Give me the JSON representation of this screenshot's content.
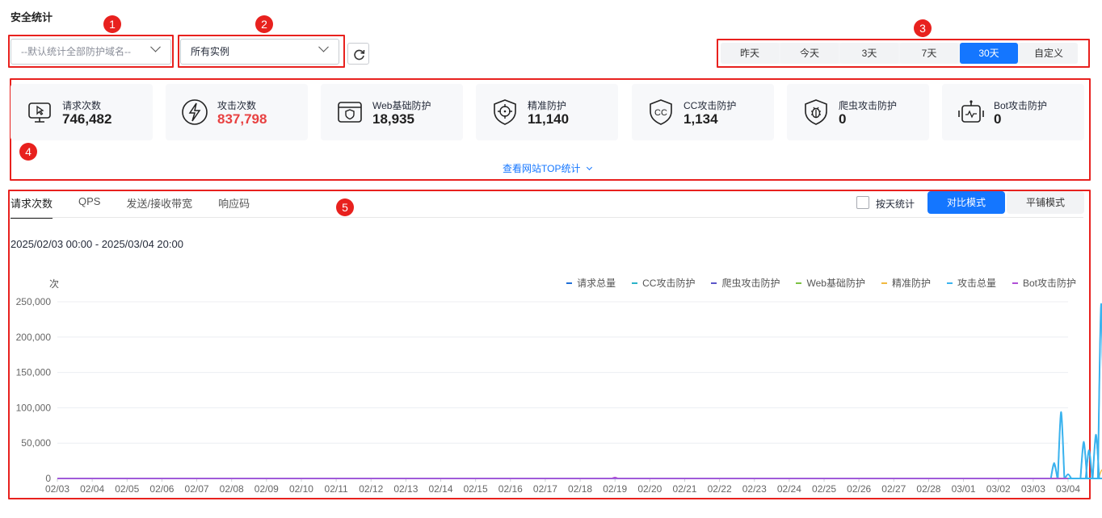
{
  "page_title": "安全统计",
  "badges": [
    "1",
    "2",
    "3",
    "4",
    "5"
  ],
  "domain_select": {
    "placeholder": "--默认统计全部防护域名--"
  },
  "instance_select": {
    "value": "所有实例"
  },
  "time_range": {
    "options": [
      "昨天",
      "今天",
      "3天",
      "7天",
      "30天",
      "自定义"
    ],
    "selected": "30天"
  },
  "stats": [
    {
      "label": "请求次数",
      "value": "746,482",
      "icon": "monitor-cursor-icon"
    },
    {
      "label": "攻击次数",
      "value": "837,798",
      "icon": "lightning-icon",
      "color": "#e84141"
    },
    {
      "label": "Web基础防护",
      "value": "18,935",
      "icon": "browser-shield-icon"
    },
    {
      "label": "精准防护",
      "value": "11,140",
      "icon": "target-shield-icon"
    },
    {
      "label": "CC攻击防护",
      "value": "1,134",
      "icon": "cc-shield-icon"
    },
    {
      "label": "爬虫攻击防护",
      "value": "0",
      "icon": "bug-shield-icon"
    },
    {
      "label": "Bot攻击防护",
      "value": "0",
      "icon": "bot-icon"
    }
  ],
  "top_link": "查看网站TOP统计",
  "tabs": [
    "请求次数",
    "QPS",
    "发送/接收带宽",
    "响应码"
  ],
  "daily_stat_label": "按天统计",
  "modes": [
    "对比模式",
    "平铺模式"
  ],
  "date_range": "2025/02/03 00:00 - 2025/03/04 20:00",
  "colors": {
    "accent": "#1476ff",
    "danger": "#e8211e"
  },
  "chart_data": {
    "type": "line",
    "ylabel": "次",
    "ylim": [
      0,
      250000
    ],
    "yticks": [
      "250,000",
      "200,000",
      "150,000",
      "100,000",
      "50,000",
      "0"
    ],
    "x": [
      "02/03",
      "02/04",
      "02/05",
      "02/06",
      "02/07",
      "02/08",
      "02/09",
      "02/10",
      "02/11",
      "02/12",
      "02/13",
      "02/14",
      "02/15",
      "02/16",
      "02/17",
      "02/18",
      "02/19",
      "02/20",
      "02/21",
      "02/22",
      "02/23",
      "02/24",
      "02/25",
      "02/26",
      "02/27",
      "02/28",
      "03/01",
      "03/02",
      "03/03",
      "03/04"
    ],
    "grid": true,
    "legend_position": "top-right",
    "series": [
      {
        "name": "请求总量",
        "color": "#1f6fd6",
        "peaks": [
          [
            28.6,
            20000
          ],
          [
            28.8,
            92000
          ],
          [
            29.0,
            6000
          ],
          [
            29.45,
            50000
          ],
          [
            29.6,
            38000
          ],
          [
            29.8,
            60000
          ],
          [
            29.95,
            245000
          ]
        ]
      },
      {
        "name": "CC攻击防护",
        "color": "#2bb3c9",
        "peaks": []
      },
      {
        "name": "爬虫攻击防护",
        "color": "#5b55c9",
        "peaks": []
      },
      {
        "name": "Web基础防护",
        "color": "#7cc142",
        "peaks": []
      },
      {
        "name": "精准防护",
        "color": "#f1b93f",
        "peaks": [
          [
            29.97,
            12000
          ]
        ]
      },
      {
        "name": "攻击总量",
        "color": "#3ab3ee",
        "peaks": [
          [
            28.6,
            22000
          ],
          [
            28.8,
            94000
          ],
          [
            29.0,
            6000
          ],
          [
            29.45,
            52000
          ],
          [
            29.6,
            40000
          ],
          [
            29.8,
            62000
          ],
          [
            29.95,
            247000
          ]
        ]
      },
      {
        "name": "Bot攻击防护",
        "color": "#b04fd6",
        "peaks": [
          [
            16.0,
            1500
          ]
        ]
      }
    ]
  }
}
